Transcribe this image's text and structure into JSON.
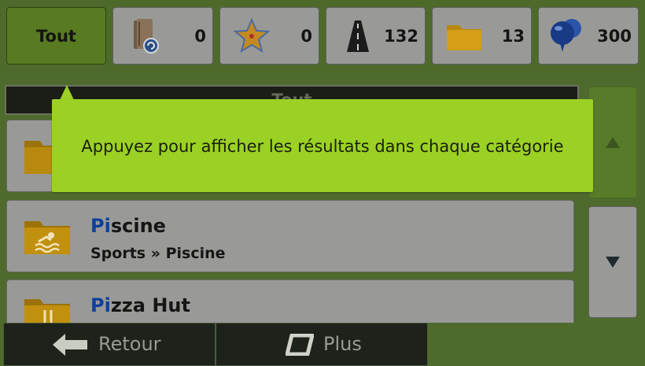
{
  "tabs": {
    "all": {
      "label": "Tout"
    },
    "history": {
      "count": "0",
      "icon": "history-book-icon"
    },
    "favorites": {
      "count": "0",
      "icon": "favorites-star-icon"
    },
    "roads": {
      "count": "132",
      "icon": "road-icon"
    },
    "categories": {
      "count": "13",
      "icon": "folder-icon"
    },
    "places": {
      "count": "300",
      "icon": "map-pin-icon"
    }
  },
  "list": {
    "section_header": "Tout",
    "rows": [
      {
        "title_match": "Pi",
        "title_rest": "scine",
        "subtitle": "Sports » Piscine",
        "icon": "swimming-folder-icon"
      },
      {
        "title_match": "Pi",
        "title_rest": "zza Hut",
        "icon": "restaurant-folder-icon"
      }
    ]
  },
  "tooltip": {
    "text": "Appuyez pour afficher les résultats dans chaque catégorie"
  },
  "bottom": {
    "back_label": "Retour",
    "more_label": "Plus"
  },
  "colors": {
    "highlight": "#0e3f9a",
    "tooltip_bg": "#9bd125",
    "active_tab": "#587b22"
  }
}
